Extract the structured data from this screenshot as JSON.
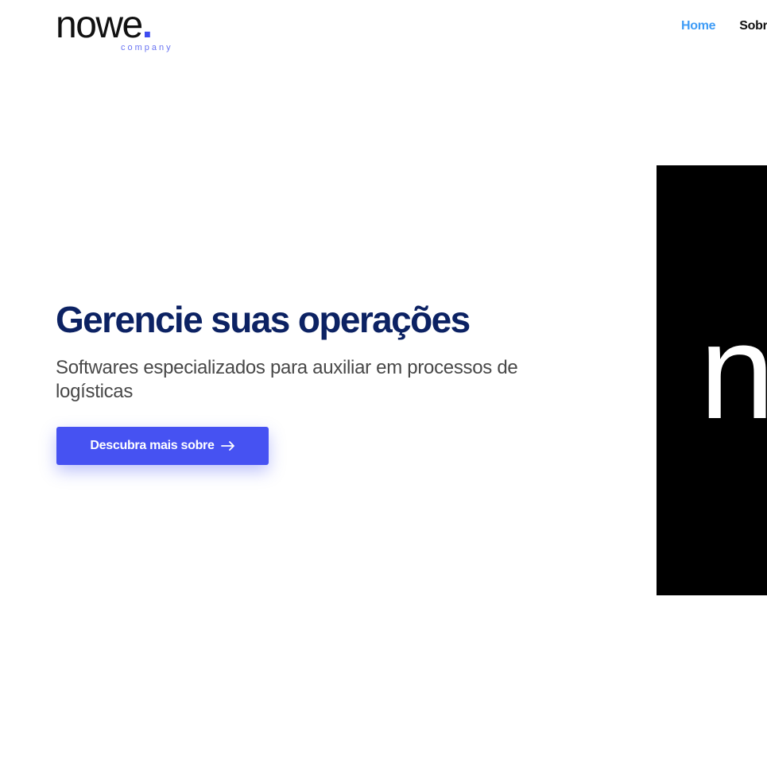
{
  "brand": {
    "name": "nowe",
    "dot": ".",
    "tagline": "company",
    "accent": "#3d4bf0"
  },
  "nav": {
    "items": [
      {
        "label": "Home",
        "active": true
      },
      {
        "label": "Sobre",
        "active": false
      }
    ],
    "active_color": "#3f9cf6"
  },
  "hero": {
    "title": "Gerencie suas operações",
    "subtitle": "Softwares especializados para auxiliar em processos de logísticas",
    "cta_label": "Descubra mais sobre",
    "cta_icon": "arrow-right-icon",
    "title_color": "#0c2263",
    "cta_color": "#4652f2"
  },
  "side_panel": {
    "glyph": "n",
    "background": "#000000"
  },
  "background": {
    "pattern": "concentric-rings",
    "ring_color": "#7f84cf"
  }
}
